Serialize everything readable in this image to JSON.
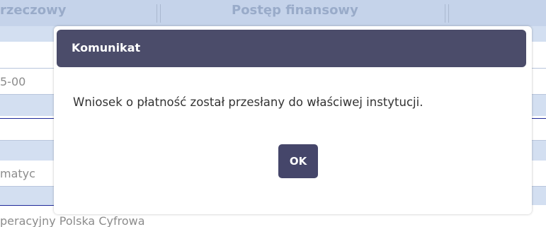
{
  "background": {
    "tabs": [
      {
        "label": "rzeczowy"
      },
      {
        "label": "Postęp finansowy"
      }
    ],
    "row_texts": [
      {
        "text": "5-00"
      },
      {
        "text": "matyc"
      },
      {
        "text": "peracyjny Polska Cyfrowa"
      }
    ]
  },
  "modal": {
    "title": "Komunikat",
    "message": "Wniosek o płatność został przesłany do właściwej instytucji.",
    "ok_label": "OK"
  },
  "colors": {
    "header_bg": "#4b4c6a",
    "button_bg": "#45466a",
    "tab_bar_bg": "#c5d3ea",
    "divider_blue": "#1f2a9a"
  }
}
